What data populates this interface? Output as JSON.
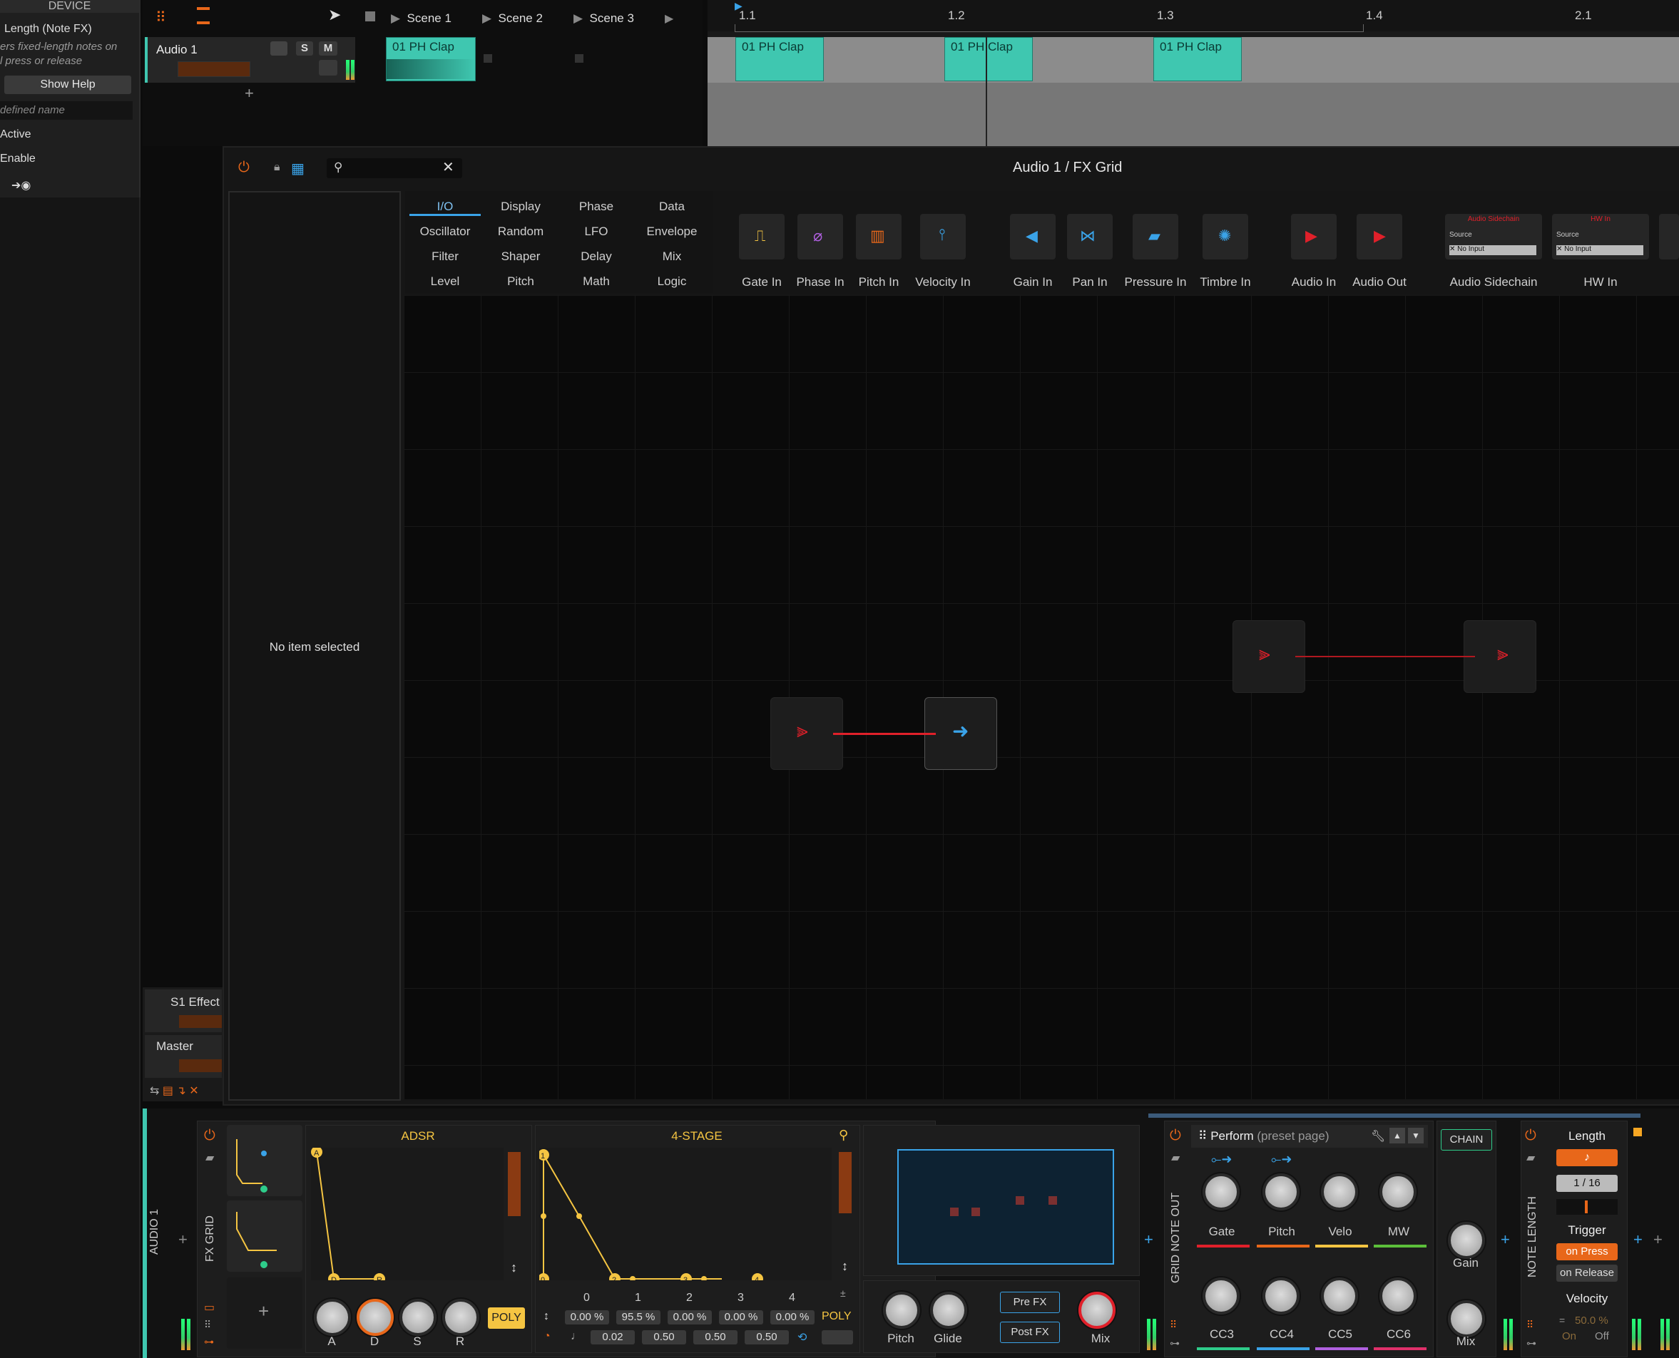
{
  "inspector": {
    "header": "DEVICE",
    "device_name": "Length (Note FX)",
    "desc_line1": "ers fixed-length notes on",
    "desc_line2": "l press or release",
    "show_help": "Show Help",
    "name_placeholder": "defined name",
    "active": "Active",
    "enable": "Enable"
  },
  "scenes": [
    "Scene 1",
    "Scene 2",
    "Scene 3"
  ],
  "track": {
    "name": "Audio 1",
    "solo": "S",
    "mute": "M",
    "clip_name": "01 PH Clap"
  },
  "ruler": [
    "1.1",
    "1.2",
    "1.3",
    "1.4",
    "2.1"
  ],
  "arranger_clips": [
    "01 PH Clap",
    "01 PH Clap",
    "01 PH Clap"
  ],
  "fx_grid": {
    "title": "Audio 1 / FX Grid",
    "no_item": "No item selected",
    "categories": [
      [
        "I/O",
        "Display",
        "Phase",
        "Data"
      ],
      [
        "Oscillator",
        "Random",
        "LFO",
        "Envelope"
      ],
      [
        "Filter",
        "Shaper",
        "Delay",
        "Mix"
      ],
      [
        "Level",
        "Pitch",
        "Math",
        "Logic"
      ]
    ],
    "modules": [
      "Gate In",
      "Phase In",
      "Pitch In",
      "Velocity In",
      "Gain In",
      "Pan In",
      "Pressure In",
      "Timbre In",
      "Audio In",
      "Audio Out",
      "Audio Sidechain",
      "HW In"
    ],
    "sidechain_header": "Audio Sidechain",
    "hw_header": "HW In",
    "source_label": "Source",
    "no_input": "No Input"
  },
  "side_tracks": [
    "S1 Effect",
    "Master"
  ],
  "devices": {
    "track_label": "AUDIO 1",
    "fx_grid_label": "FX GRID",
    "adsr": {
      "title": "ADSR",
      "knobs": [
        "A",
        "D",
        "S",
        "R"
      ],
      "poly": "POLY",
      "points": [
        "A",
        "D",
        "R"
      ]
    },
    "four_stage": {
      "title": "4-STAGE",
      "stage_nums": [
        "0",
        "1",
        "2",
        "3",
        "4"
      ],
      "levels": [
        "0.00 %",
        "95.5 %",
        "0.00 %",
        "0.00 %",
        "0.00 %"
      ],
      "times": [
        "0.02",
        "0.50",
        "0.50",
        "0.50"
      ],
      "poly": "POLY",
      "points": [
        "1",
        "0",
        "2",
        "3",
        "4"
      ]
    },
    "fx_knobs": [
      "Pitch",
      "Glide",
      "Mix"
    ],
    "pre_fx": "Pre FX",
    "post_fx": "Post FX",
    "grid_note_out": "GRID NOTE OUT",
    "perform": "Perform",
    "preset_page": "(preset page)",
    "macros_top": [
      "Gate",
      "Pitch",
      "Velo",
      "MW"
    ],
    "macros_bottom": [
      "CC3",
      "CC4",
      "CC5",
      "CC6"
    ],
    "chain": "CHAIN",
    "chain_knobs": [
      "Gain",
      "Mix"
    ],
    "note_length_label": "NOTE LENGTH",
    "length": {
      "title": "Length",
      "note": "♪",
      "value": "1 / 16",
      "trigger": "Trigger",
      "on_press": "on Press",
      "on_release": "on Release",
      "velocity": "Velocity",
      "velocity_value": "50.0 %",
      "on": "On",
      "off": "Off"
    }
  },
  "colors": {
    "accent": "#e8671a",
    "clip": "#3fc7b0",
    "audio_red": "#e0202a",
    "note_blue": "#3aa3e8",
    "envelope": "#f5c542"
  }
}
